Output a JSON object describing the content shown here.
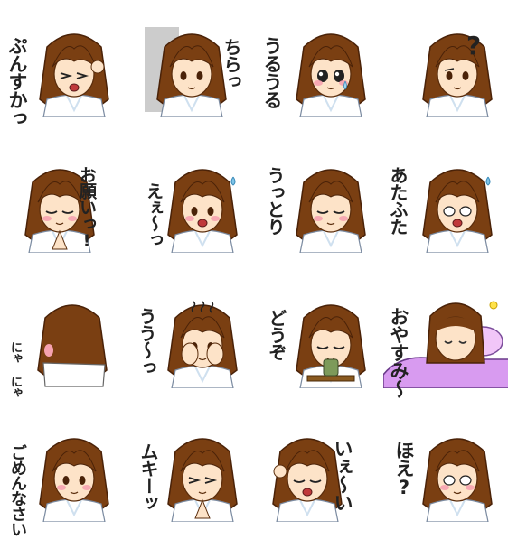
{
  "stickers": [
    {
      "id": 1,
      "text": "ぷんすかっ",
      "expression": "angry-fist"
    },
    {
      "id": 2,
      "text": "ちらっ",
      "expression": "peek-behind-wall"
    },
    {
      "id": 3,
      "text": "うるうる",
      "expression": "teary-eyes"
    },
    {
      "id": 4,
      "text": "?",
      "expression": "confused"
    },
    {
      "id": 5,
      "text": "お願いっ!",
      "expression": "pleading-hands"
    },
    {
      "id": 6,
      "text": "えぇ〜っ",
      "expression": "shocked-sweat"
    },
    {
      "id": 7,
      "text": "うっとり",
      "expression": "dreamy-blush"
    },
    {
      "id": 8,
      "text": "あたふた",
      "expression": "panicked"
    },
    {
      "id": 9,
      "text": "にゃ にゃ",
      "expression": "back-turned"
    },
    {
      "id": 10,
      "text": "うう〜っ",
      "expression": "gloomy-hands-face"
    },
    {
      "id": 11,
      "text": "どうぞ",
      "expression": "offering-tea"
    },
    {
      "id": 12,
      "text": "おやすみ〜",
      "expression": "sleeping-in-bed"
    },
    {
      "id": 13,
      "text": "ごめんなさい",
      "expression": "apologetic-blush"
    },
    {
      "id": 14,
      "text": "ムキーッ",
      "expression": "frustrated"
    },
    {
      "id": 15,
      "text": "いぇ〜い",
      "expression": "cheering-fist"
    },
    {
      "id": 16,
      "text": "ほえ?",
      "expression": "blank-blush"
    }
  ],
  "colors": {
    "hair": "#7a3f12",
    "hair_dark": "#4a2208",
    "skin": "#fde3c8",
    "robe": "#ffffff",
    "robe_shadow": "#cfe0ef",
    "blush": "#f6a2b0",
    "wall": "#cccccc",
    "bed": "#d89bf0"
  }
}
